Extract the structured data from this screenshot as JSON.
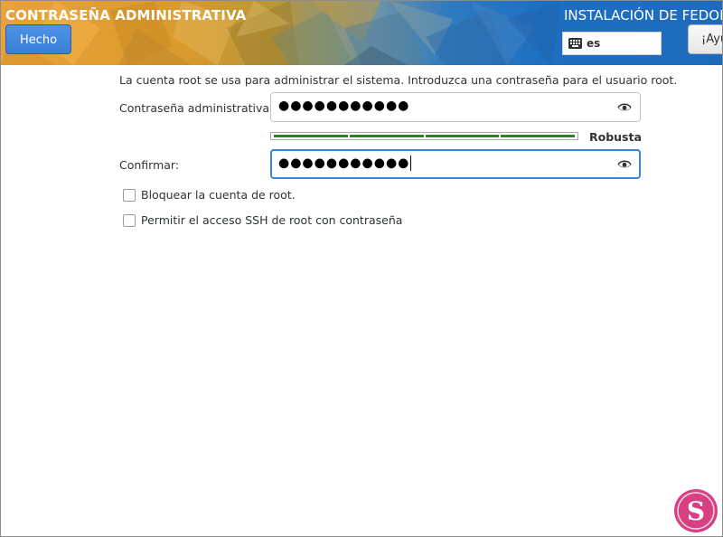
{
  "header": {
    "title": "CONTRASEÑA ADMINISTRATIVA",
    "done_label": "Hecho",
    "install_title": "INSTALACIÓN DE FEDORA",
    "keyboard_layout": "es",
    "help_label": "¡Ayuda!"
  },
  "main": {
    "description": "La cuenta root se usa para administrar el sistema. Introduzca una contraseña para el usuario root.",
    "password_label": "Contraseña administrativa:",
    "password_value": "●●●●●●●●●●●",
    "strength_level": 1.0,
    "strength_segments": 4,
    "strength_label": "Robusta",
    "confirm_label": "Confirmar:",
    "confirm_value": "●●●●●●●●●●●",
    "lock_root_label": "Bloquear la cuenta de root.",
    "lock_root_checked": false,
    "ssh_label": "Permitir el acceso SSH de root con contraseña",
    "ssh_checked": false
  },
  "colors": {
    "accent": "#3584e4",
    "strength_bar": "#26861c",
    "banner_left": "#e9a23a",
    "banner_right": "#1e6bbd"
  },
  "icons": [
    "keyboard-icon",
    "eye-icon",
    "watermark-logo"
  ]
}
